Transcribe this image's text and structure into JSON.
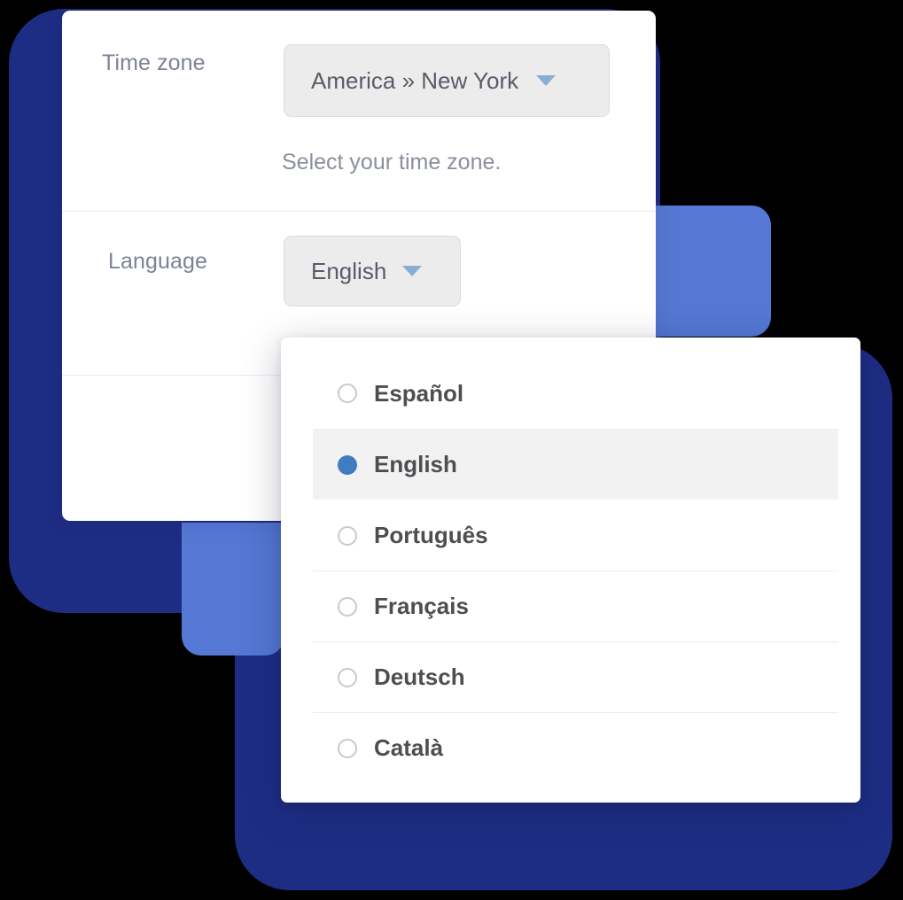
{
  "theme": {
    "navy": "#1e2d84",
    "blue": "#5478d4",
    "accent_radio": "#3f7cc0",
    "caret": "#8aaed0",
    "control_bg": "#ececed",
    "selected_row_bg": "#f2f2f3"
  },
  "card": {
    "rows": {
      "timezone": {
        "label": "Time zone",
        "value": "America » New York",
        "help": "Select your time zone.",
        "caret": "chevron-down-icon"
      },
      "language": {
        "label": "Language",
        "value": "English",
        "caret": "chevron-down-icon"
      }
    }
  },
  "language_dropdown": {
    "selected": "English",
    "options": [
      {
        "label": "Español",
        "selected": false
      },
      {
        "label": "English",
        "selected": true
      },
      {
        "label": "Português",
        "selected": false
      },
      {
        "label": "Français",
        "selected": false
      },
      {
        "label": "Deutsch",
        "selected": false
      },
      {
        "label": "Català",
        "selected": false
      }
    ]
  }
}
